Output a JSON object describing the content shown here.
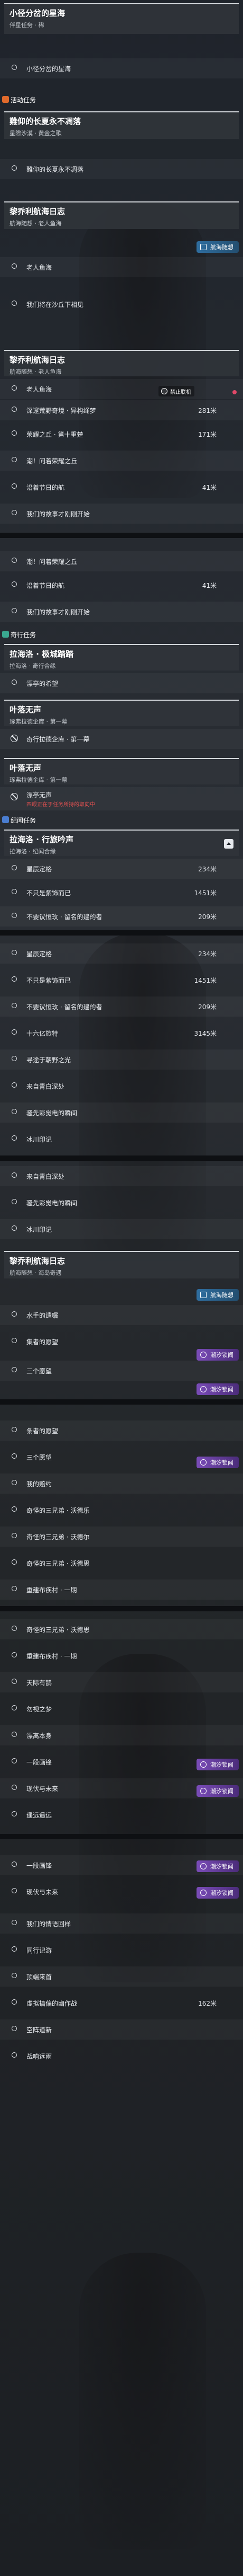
{
  "categories": {
    "activity": "活动任务",
    "legend": "奇行任务",
    "world": "纪闻任务"
  },
  "cards": {
    "c0": {
      "title": "小径分岔的星海",
      "subtitle": "伴星任务 · 稀"
    },
    "c1": {
      "title": "難仰的长夏永不凋落",
      "subtitle": "星際沙漠 · 黄金之歌"
    },
    "c2": {
      "title": "黎乔利航海日志",
      "subtitle": "航海随想 · 老人鱼海"
    },
    "c3": {
      "title": "黎乔利航海日志",
      "subtitle": "航海随想 · 老人鱼海"
    },
    "c4": {
      "title": "拉海洛 · 极城踏踏",
      "subtitle": "拉海洛 · 奇行合缘"
    },
    "c5": {
      "title": "叶落无声",
      "subtitle": "琢弗拉德企库 · 第一幕"
    },
    "c6": {
      "title": "叶落无声",
      "subtitle": "琢弗拉德企库 · 第一幕"
    },
    "c7": {
      "title": "拉海洛 · 行旅吟声",
      "subtitle": "拉海洛 · 纪闻合缘"
    },
    "c8": {
      "title": "黎乔利航海日志",
      "subtitle": "航海随想 · 海岛奇遇"
    }
  },
  "badges": {
    "ocean": "航海随想",
    "tide": "潮汐锁闻",
    "forbidden": "禁止联机"
  },
  "hint_red": "四眼正在于任务所持的取向中",
  "rows": {
    "r0": "小径分岔的星海",
    "r1": "難仰的长夏永不凋落",
    "r2": "老人鱼海",
    "r3": "我们将在沙丘下相见",
    "r4": "老人鱼海",
    "r5": "深邃荒野奇境 · 异构绳梦",
    "r6": "荣耀之丘 · 第十重楚",
    "r7": "潮！问着荣耀之丘",
    "r8": "沿着节日的航",
    "r9": "我们的故事才刚刚开始",
    "r10": "潮！问着荣耀之丘",
    "r11": "沿着节日的航",
    "r12": "我们的故事才刚刚开始",
    "r13": "漂亭的希望",
    "r14": "奇行拉德企库 · 第一幕",
    "r15": "漂亭无声",
    "r16": "漂落无声",
    "r17": "星辰定格",
    "r18": "不只是紫饰而已",
    "r19": "不要议恒玫 · 留名的建的者",
    "r20": "星辰定格",
    "r21": "不只是紫饰而已",
    "r22": "不要议恒玫 · 留名的建的者",
    "r23": "十六亿旅特",
    "r24": "寻途于朝野之光",
    "r25": "来自青白深处",
    "r26": "骚先彩觉电的瞬间",
    "r27": "冰川印记",
    "r28": "来自青白深处",
    "r29": "骚先彩觉电的瞬间",
    "r30": "冰川印记",
    "r31": "水手的遗嘱",
    "r32": "集者的愿望",
    "r33": "三个愿望",
    "r34": "条者的愿望",
    "r35": "三个愿望",
    "r36": "我的赔约",
    "r37": "奇怪的三兄弟 · 沃德乐",
    "r38": "奇怪的三兄弟 · 沃德尔",
    "r39": "奇怪的三兄弟 · 沃德思",
    "r40": "重建布疾村 · 一期",
    "r41": "奇怪的三兄弟 · 沃德思",
    "r42": "重建布疾村 · 一期",
    "r43": "天际有鹊",
    "r44": "勿视之梦",
    "r45": "漂离本身",
    "r46": "一段画锋",
    "r47": "现伏与未来",
    "r48": "遥远遥远",
    "r49": "一段画锋",
    "r50": "现伏与未来",
    "r51": "我们的情语回样",
    "r52": "同行记游",
    "r53": "顶端来首",
    "r54": "虚拟搞偏的幽作战",
    "r55": "空阵道新",
    "r56": "战响远雨"
  },
  "distances": {
    "d0": "281米",
    "d1": "171米",
    "d2": "41米",
    "d3": "41米",
    "d4": "234米",
    "d5": "1451米",
    "d6": "209米",
    "d7": "234米",
    "d8": "1451米",
    "d9": "209米",
    "d10": "3145米",
    "d11": "162米"
  },
  "colors": {
    "accent_activity": "#e06a2c",
    "accent_legend": "#3aa890",
    "accent_world": "#4a7dd0",
    "badge_tide": "#7a4cb8",
    "badge_ocean": "#2f6ea0",
    "hint": "#e05050"
  }
}
